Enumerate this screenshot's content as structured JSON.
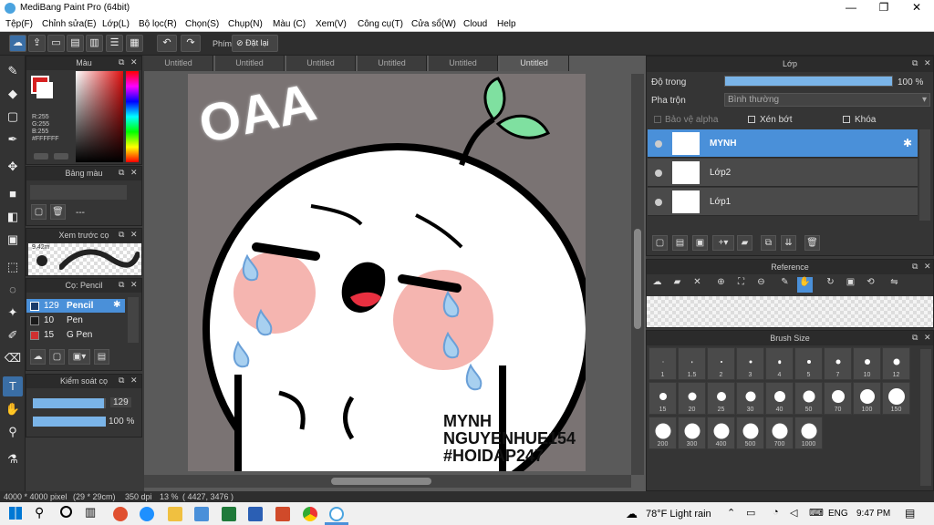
{
  "window": {
    "title": "MediBang Paint Pro (64bit)"
  },
  "menu": [
    "Tệp(F)",
    "Chỉnh sửa(E)",
    "Lớp(L)",
    "Bộ lọc(R)",
    "Chọn(S)",
    "Chụp(N)",
    "Màu (C)",
    "Xem(V)",
    "Công cụ(T)",
    "Cửa sổ(W)",
    "Cloud",
    "Help"
  ],
  "toolbar": {
    "shortcut_label": "Phím",
    "reset_label": "Đặt lại"
  },
  "color_panel": {
    "title": "Màu",
    "r": "R:255",
    "g": "G:255",
    "b": "B:255",
    "hex": "#FFFFFF"
  },
  "palette_panel": {
    "title": "Bảng màu",
    "value": "---"
  },
  "brush_preview": {
    "title": "Xem trước cọ",
    "size": "9.42m"
  },
  "brush_panel": {
    "title": "Cọ: Pencil",
    "brushes": [
      {
        "size": "129",
        "name": "Pencil",
        "color": "#1a3a6a"
      },
      {
        "size": "10",
        "name": "Pen",
        "color": "#1a1a1a"
      },
      {
        "size": "15",
        "name": "G Pen",
        "color": "#d03030"
      }
    ]
  },
  "brush_control": {
    "title": "Kiểm soát cọ",
    "size_value": "129",
    "size_fraction": 0.98,
    "opacity_value": "100 %",
    "opacity_fraction": 1.0
  },
  "tabs": [
    "Untitled",
    "Untitled",
    "Untitled",
    "Untitled",
    "Untitled",
    "Untitled"
  ],
  "artwork": {
    "text_top": "OAA",
    "sign1": "MYNH",
    "sign2": "NGUYENHUE154",
    "sign3": "#HOIDAP247"
  },
  "layer_panel": {
    "title": "Lớp",
    "opacity_label": "Độ trong",
    "opacity_value": "100 %",
    "blend_label": "Pha trộn",
    "blend_value": "Bình thường",
    "protect_alpha": "Bảo vệ alpha",
    "clipping": "Xén bớt",
    "lock": "Khóa",
    "layers": [
      {
        "name": "MYNH",
        "selected": true
      },
      {
        "name": "Lớp2",
        "selected": false
      },
      {
        "name": "Lớp1",
        "selected": false
      }
    ]
  },
  "reference_panel": {
    "title": "Reference"
  },
  "brush_size_panel": {
    "title": "Brush Size",
    "sizes": [
      "1",
      "1.5",
      "2",
      "3",
      "4",
      "5",
      "7",
      "10",
      "12",
      "15",
      "20",
      "25",
      "30",
      "40",
      "50",
      "70",
      "100",
      "150",
      "200",
      "300",
      "400",
      "500",
      "700",
      "1000"
    ]
  },
  "status": {
    "dimensions": "4000 * 4000 pixel",
    "physical": "(29 * 29cm)",
    "dpi": "350 dpi",
    "zoom": "13 %",
    "coords": "( 4427, 3476 )"
  },
  "taskbar": {
    "weather": "78°F  Light rain",
    "lang": "ENG",
    "time": "9:47 PM"
  },
  "colors": {
    "accent": "#4a90d9",
    "panel": "#353535"
  }
}
